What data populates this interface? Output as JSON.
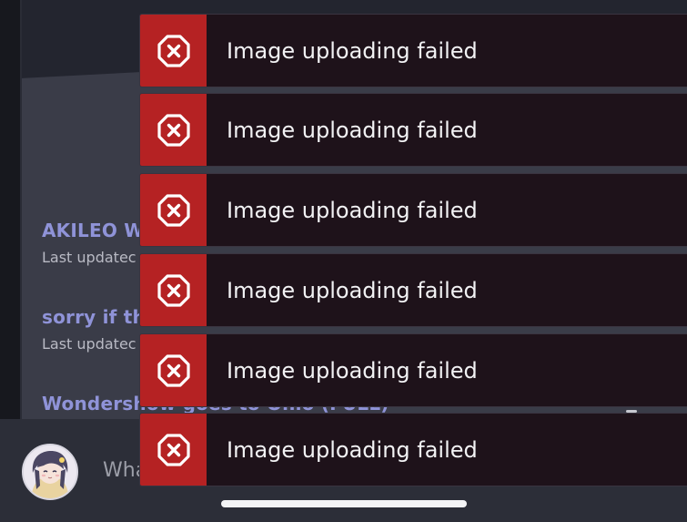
{
  "threads": [
    {
      "title": "AKILEO WI",
      "meta": "Last updatec"
    },
    {
      "title": "sorry if th",
      "meta": "Last updatec"
    },
    {
      "title": "Wondershow goes to Ohio (FULL)"
    }
  ],
  "composer": {
    "placeholder": "Wha"
  },
  "toasts": [
    {
      "message": "Image uploading failed",
      "icon": "error-octagon-icon"
    },
    {
      "message": "Image uploading failed",
      "icon": "error-octagon-icon"
    },
    {
      "message": "Image uploading failed",
      "icon": "error-octagon-icon"
    },
    {
      "message": "Image uploading failed",
      "icon": "error-octagon-icon"
    },
    {
      "message": "Image uploading failed",
      "icon": "error-octagon-icon"
    },
    {
      "message": "Image uploading failed",
      "icon": "error-octagon-icon"
    }
  ],
  "colors": {
    "toast_accent": "#b52223",
    "toast_background": "#1e121a",
    "thread_title": "#8f93d8"
  }
}
